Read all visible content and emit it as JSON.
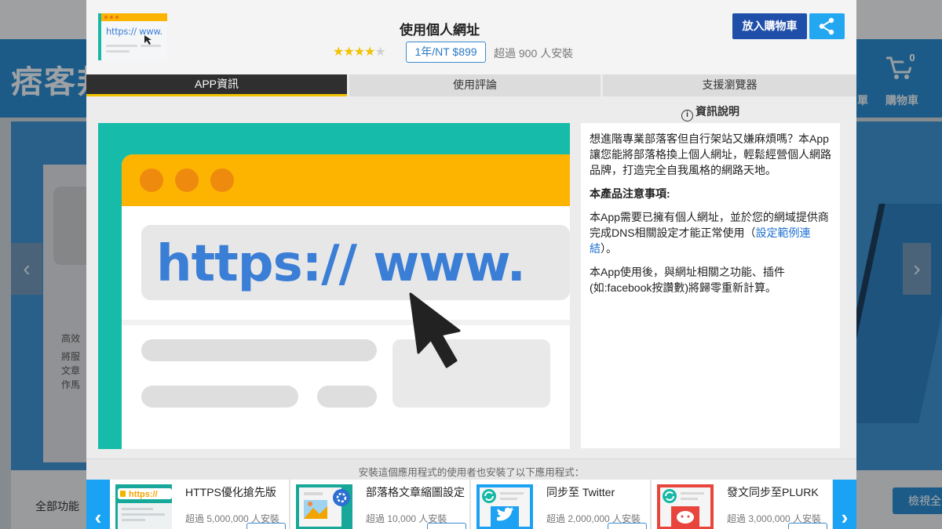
{
  "background": {
    "logo_text": "痞客邦",
    "nav_partial": "單",
    "cart": {
      "count": "0",
      "label": "購物車"
    },
    "side_texts": [
      "高效",
      "將服",
      "文章",
      "作馬"
    ],
    "footer_label": "全部功能",
    "footer_button": "檢視全"
  },
  "app": {
    "title": "使用個人網址",
    "thumb_url_text": "https:// www.",
    "rating": 4,
    "rating_max": 5,
    "price": "1年/NT $899",
    "install_count": "超過 900 人安裝"
  },
  "actions": {
    "add_to_cart": "放入購物車",
    "share_icon": "share-icon"
  },
  "tabs": [
    {
      "label": "APP資訊",
      "active": true
    },
    {
      "label": "使用評論",
      "active": false
    },
    {
      "label": "支援瀏覽器",
      "active": false
    }
  ],
  "info": {
    "heading": "資訊說明",
    "icon": "info-icon",
    "intro": "想進階專業部落客但自行架站又嫌麻煩嗎？本App讓您能將部落格換上個人網址，輕鬆經營個人網路品牌，打造完全自我風格的網路天地。",
    "notice_title": "本產品注意事項:",
    "notice_text_before": "本App需要已擁有個人網址，並於您的網域提供商完成DNS相關設定才能正常使用（",
    "notice_link": "設定範例連結",
    "notice_text_after": "）。",
    "reset_note": "本App使用後，與網址相關之功能、插件(如:facebook按讚數)將歸零重新計算。"
  },
  "screenshot": {
    "url_text": "https:// www.",
    "cursor_icon": "mouse-pointer-icon"
  },
  "related": {
    "caption": "安裝這個應用程式的使用者也安裝了以下應用程式：",
    "prev_icon": "chevron-left-icon",
    "next_icon": "chevron-right-icon",
    "items": [
      {
        "name": "HTTPS優化搶先版",
        "installs": "超過 5,000,000 人安裝",
        "thumb_text": "https://"
      },
      {
        "name": "部落格文章縮圖設定",
        "installs": "超過 10,000 人安裝"
      },
      {
        "name": "同步至 Twitter",
        "installs": "超過 2,000,000 人安裝"
      },
      {
        "name": "發文同步至PLURK",
        "installs": "超過 3,000,000 人安裝"
      }
    ]
  },
  "colors": {
    "teal": "#17bba9",
    "browser_bar": "#fcb400",
    "url_blue": "#3b7ed6",
    "primary_button": "#1f4fa8",
    "share_button": "#23a7f1",
    "active_tab": "#2f2f2f",
    "tab_underline": "#f2c200"
  }
}
